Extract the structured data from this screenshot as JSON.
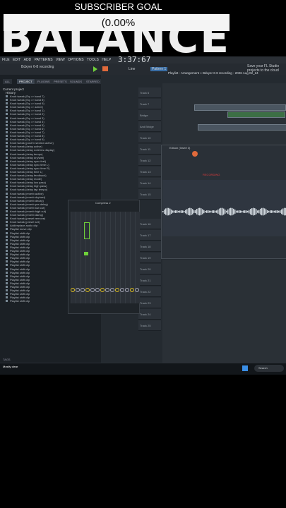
{
  "overlay": {
    "title": "SUBSCRIBER GOAL",
    "percent": "(0.00%",
    "big_text": "BALANCE"
  },
  "menubar": {
    "items": [
      "FILE",
      "EDIT",
      "ADD",
      "PATTERNS",
      "VIEW",
      "OPTIONS",
      "TOOLS",
      "HELP"
    ]
  },
  "toolbar": {
    "recording": "Bdxyer 6-8 recording",
    "time": "3:37:67",
    "pattern": "Pattern 1",
    "mode": "Line",
    "hint": "Save your FL Studio projects to the cloud"
  },
  "browser": {
    "tabs": [
      "ALL",
      "PROJECT",
      "PLUGINS",
      "PRESETS",
      "SOUNDS",
      "STARRED"
    ],
    "current_project": "Current project",
    "history_label": "History",
    "history": [
      "Knob tweak (Eq >> band 7)",
      "Knob tweak (Eq >> band 8)",
      "Knob tweak (Eq >> band 9)",
      "Knob tweak (Eq >> active)",
      "Knob tweak (Eq >> band 1)",
      "Knob tweak (Eq >> band 2)",
      "Knob tweak (Eq >> band 3)",
      "Knob tweak (Eq >> band 4)",
      "Knob tweak (Eq >> band 5)",
      "Knob tweak (Eq >> band 6)",
      "Knob tweak (Eq >> band 7)",
      "Knob tweak (Eq >> band 8)",
      "Knob tweak (Eq >> band 9)",
      "Knob tweak (post fx section active)",
      "Knob tweak (delay active)",
      "Knob tweak (delay note/ms display)",
      "Knob tweak (delay tempo)",
      "Knob tweak (delay dry/wet)",
      "Knob tweak (delay sync feel)",
      "Knob tweak (delay sync time L)",
      "Knob tweak (delay sync time R)",
      "Knob tweak (delay time L)",
      "Knob tweak (delay feedback)",
      "Knob tweak (delay mode)",
      "Knob tweak (delay low pass)",
      "Knob tweak (delay high pass)",
      "Knob tweak (delay tap tempo)",
      "Knob tweak (reverb active)",
      "Knob tweak (reverb dry/wet)",
      "Knob tweak (reverb decay)",
      "Knob tweak (reverb pre-delay)",
      "Knob tweak (reverb low cut)",
      "Knob tweak (reverb high cut)",
      "Knob tweak (reverb damp)",
      "Knob tweak (preset remove)",
      "Knob tweak (preset set)",
      "Add/replace audio clip",
      "Playlist move clip",
      "Playlist shift clip",
      "Playlist shift clip",
      "Playlist shift clip",
      "Playlist shift clip",
      "Playlist shift clip",
      "Playlist shift clip",
      "Playlist shift clip",
      "Playlist shift clip",
      "Playlist shift clip",
      "Playlist shift clip",
      "Playlist shift clip",
      "Playlist shift clip",
      "Playlist shift clip",
      "Playlist shift clip",
      "Playlist shift clip",
      "Playlist shift clip",
      "Playlist shift clip",
      "Playlist shift clip",
      "Playlist shift clip",
      "Playlist shift clip"
    ],
    "footer": "TAGS"
  },
  "playlist": {
    "title": "Playlist - Arrangement » Bdxyer 6-8 recording - 2026 Aug 02_24",
    "tracks": [
      "Track 6",
      "Track 7",
      "Bridge",
      "And Bridge",
      "Track 10",
      "Track 11",
      "Track 12",
      "Track 13",
      "Track 14",
      "Track 15",
      "Track 16",
      "Track 17",
      "Track 18",
      "Track 19",
      "Track 20",
      "Track 21",
      "Track 22",
      "Track 23",
      "Track 24",
      "Track 25"
    ]
  },
  "edison": {
    "title": "Edison (Insert 3)",
    "label": "RECORDING"
  },
  "mixer": {
    "title": "Compress 2"
  },
  "taskbar": {
    "search": "Search",
    "weather": "Mostly clear"
  },
  "colors": {
    "accent": "#e06a3b",
    "green": "#6fd03a",
    "yellow": "#e0c020"
  }
}
